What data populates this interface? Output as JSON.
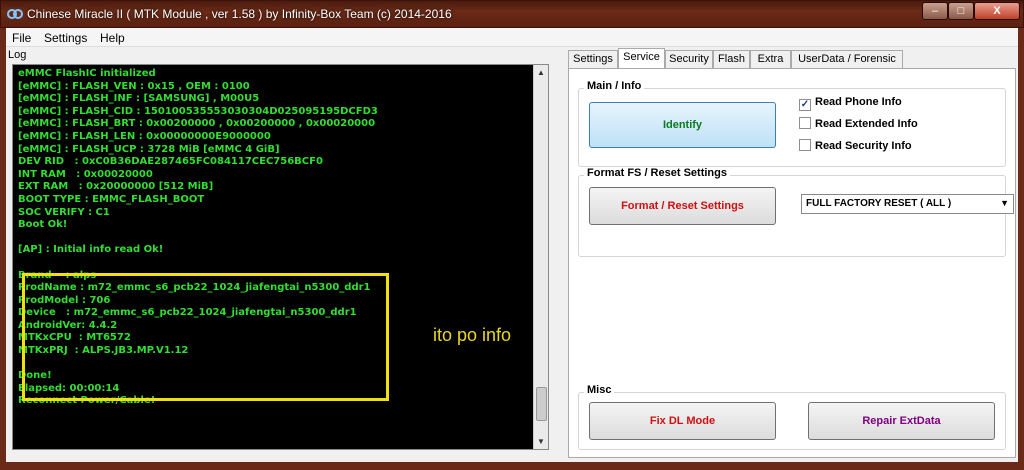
{
  "window": {
    "title": "Chinese Miracle II ( MTK Module , ver 1.58 ) by Infinity-Box Team (c) 2014-2016",
    "buttons": {
      "minimize": "–",
      "maximize": "□",
      "close": "X"
    }
  },
  "menu": [
    "File",
    "Settings",
    "Help"
  ],
  "log": {
    "label": "Log",
    "lines": [
      "eMMC FlashIC initialized",
      "[eMMC] : FLASH_VEN : 0x15 , OEM : 0100",
      "[eMMC] : FLASH_INF : [SAMSUNG] , M00U5",
      "[eMMC] : FLASH_CID : 150100535553030304D025095195DCFD3",
      "[eMMC] : FLASH_BRT : 0x00200000 , 0x00200000 , 0x00020000",
      "[eMMC] : FLASH_LEN : 0x00000000E9000000",
      "[eMMC] : FLASH_UCP : 3728 MiB [eMMC 4 GiB]",
      "DEV RID   : 0xC0B36DAE287465FC084117CEC756BCF0",
      "INT RAM   : 0x00020000",
      "EXT RAM   : 0x20000000 [512 MiB]",
      "BOOT TYPE : EMMC_FLASH_BOOT",
      "SOC VERIFY : C1",
      "Boot Ok!",
      "",
      "[AP] : Initial info read Ok!",
      "",
      "Brand    : alps",
      "ProdName : m72_emmc_s6_pcb22_1024_jiafengtai_n5300_ddr1",
      "ProdModel : 706",
      "Device   : m72_emmc_s6_pcb22_1024_jiafengtai_n5300_ddr1",
      "AndroidVer: 4.4.2",
      "MTKxCPU  : MT6572",
      "MTKxPRJ  : ALPS.JB3.MP.V1.12",
      "",
      "Done!",
      "Elapsed: 00:00:14",
      "Reconnect Power/Cable!"
    ],
    "annotation": "ito po info"
  },
  "tabs": [
    "Settings",
    "Service",
    "Security",
    "Flash",
    "Extra",
    "UserData / Forensic"
  ],
  "active_tab": "Service",
  "main_info": {
    "title": "Main / Info",
    "identify_button": "Identify",
    "checkboxes": [
      {
        "label": "Read Phone Info",
        "checked": true
      },
      {
        "label": "Read Extended Info",
        "checked": false
      },
      {
        "label": "Read Security Info",
        "checked": false
      }
    ]
  },
  "format": {
    "title": "Format FS / Reset Settings",
    "button": "Format / Reset Settings",
    "select_value": "FULL FACTORY RESET ( ALL )"
  },
  "misc": {
    "title": "Misc",
    "fix_dl": "Fix DL Mode",
    "repair": "Repair ExtData"
  }
}
